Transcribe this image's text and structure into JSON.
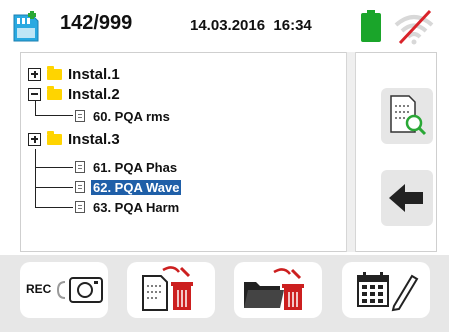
{
  "header": {
    "memory_count": "142/999",
    "datetime": "14.03.2016  16:34",
    "icons": [
      "memory-card-icon",
      "battery-icon",
      "wifi-disabled-icon"
    ],
    "battery_color": "#1aa52a"
  },
  "tree": {
    "groups": [
      {
        "label": "Instal.1",
        "expanded": false
      },
      {
        "label": "Instal.2",
        "expanded": true,
        "items": [
          "60. PQA rms"
        ]
      },
      {
        "label": "Instal.3",
        "expanded": true,
        "items": [
          "61. PQA Phas",
          "62. PQA Wave",
          "63. PQA Harm"
        ]
      }
    ],
    "selected_item": "62. PQA Wave",
    "selection_color": "#1f5fa8"
  },
  "side_buttons": [
    "view-document-icon",
    "back-arrow-icon"
  ],
  "bottom_buttons": {
    "rec_label": "REC",
    "icons": [
      "rec-camera-icon",
      "delete-document-icon",
      "delete-folder-icon",
      "calendar-edit-icon"
    ],
    "delete_color": "#cc1f1f"
  }
}
